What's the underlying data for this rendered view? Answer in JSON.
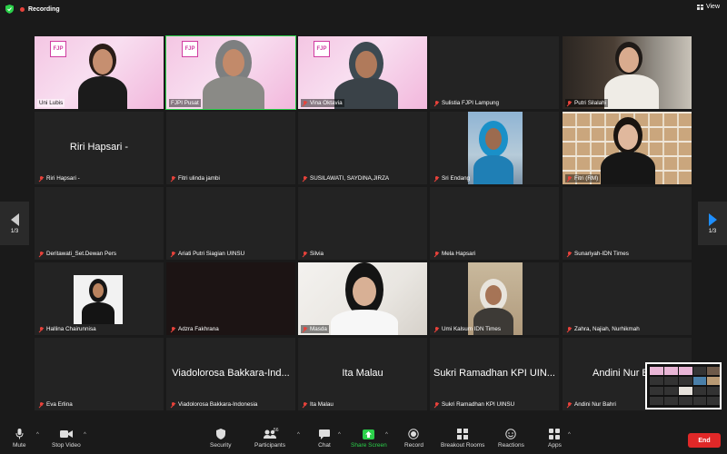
{
  "topbar": {
    "recording_label": "Recording",
    "view_label": "View"
  },
  "pager": {
    "left_label": "1/3",
    "right_label": "1/3"
  },
  "tiles": [
    {
      "name": "Uni Lubis",
      "center": ""
    },
    {
      "name": "FJPI Pusat",
      "center": ""
    },
    {
      "name": "Vina Oktavia",
      "center": ""
    },
    {
      "name": "Sulistia FJPI Lampung",
      "center": ""
    },
    {
      "name": "Putri Silalahi",
      "center": ""
    },
    {
      "name": "Riri Hapsari -",
      "center": "Riri Hapsari -"
    },
    {
      "name": "Fitri ulinda jambi",
      "center": ""
    },
    {
      "name": "SUSILAWATI, SAYDINA,JIRZA",
      "center": ""
    },
    {
      "name": "Sri Endang",
      "center": ""
    },
    {
      "name": "Fitri (RM)",
      "center": ""
    },
    {
      "name": "Deritawati_Set.Dewan Pers",
      "center": ""
    },
    {
      "name": "Ariati Putri Siagian UINSU",
      "center": ""
    },
    {
      "name": "Silvia",
      "center": ""
    },
    {
      "name": "Mela Hapsari",
      "center": ""
    },
    {
      "name": "Sunariyah-IDN Times",
      "center": ""
    },
    {
      "name": "Hallina Chairunnisa",
      "center": ""
    },
    {
      "name": "Adzra Fakhrana",
      "center": ""
    },
    {
      "name": "Masda",
      "center": ""
    },
    {
      "name": "Umi Kalsum IDN Times",
      "center": ""
    },
    {
      "name": "Zahra, Najiah, Nurhikmah",
      "center": ""
    },
    {
      "name": "Eva Erlina",
      "center": ""
    },
    {
      "name": "Viadolorosa Bakkara-Indonesia",
      "center": "Viadolorosa Bakkara-Ind..."
    },
    {
      "name": "Ita Malau",
      "center": "Ita Malau"
    },
    {
      "name": "Sukri Ramadhan KPI UINSU",
      "center": "Sukri Ramadhan KPI UIN..."
    },
    {
      "name": "Andini Nur Bahri",
      "center": "Andini Nur B"
    }
  ],
  "logo_text": "FJP",
  "toolbar": {
    "mute": "Mute",
    "stop_video": "Stop Video",
    "security": "Security",
    "participants": "Participants",
    "participants_count": "56",
    "chat": "Chat",
    "share_screen": "Share Screen",
    "record": "Record",
    "breakout_rooms": "Breakout Rooms",
    "reactions": "Reactions",
    "apps": "Apps",
    "end": "End"
  },
  "colors": {
    "accent_green": "#2bd04a",
    "end_red": "#e02828",
    "pager_blue": "#1e8fff",
    "brand_pink": "#d03ca1"
  }
}
